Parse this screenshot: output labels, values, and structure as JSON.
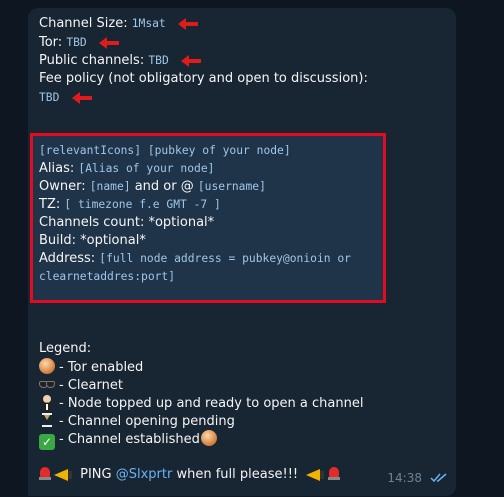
{
  "header": {
    "channel_size_label": "Channel Size:",
    "channel_size_value": "1Msat",
    "tor_label": "Tor:",
    "tor_value": "TBD",
    "public_channels_label": "Public channels:",
    "public_channels_value": "TBD",
    "fee_policy_label": "Fee policy (not obligatory and open to discussion):",
    "fee_policy_value": "TBD"
  },
  "template": {
    "icons_pubkey": "[relevantIcons]  [pubkey of your node]",
    "alias_label": "Alias:",
    "alias_value": "[Alias of your node]",
    "owner_label": "Owner:",
    "owner_name": "[name]",
    "owner_and_or": " and or  @",
    "owner_username": "[username]",
    "tz_label": "TZ:",
    "tz_value": "[ timezone f.e GMT -7 ]",
    "channels_count": "Channels count: *optional*",
    "build": "Build: *optional*",
    "address_label": "Address:",
    "address_value_1": "[full node address = pubkey@onioin or",
    "address_value_2": "clearnetaddres:port]"
  },
  "legend": {
    "title": "Legend:",
    "items": [
      {
        "icon": "onion-icon",
        "text": "- Tor enabled"
      },
      {
        "icon": "sunglasses-icon",
        "text": "- Clearnet"
      },
      {
        "icon": "person-icon",
        "text": "- Node topped up and ready to open a channel"
      },
      {
        "icon": "hourglass-icon",
        "text": "- Channel opening pending"
      },
      {
        "icon": "check-mark-icon",
        "text": "- Channel established"
      }
    ]
  },
  "footer": {
    "ping_text": " PING ",
    "mention": "@Slxprtr",
    "ping_suffix": "  when full please!!!"
  },
  "meta": {
    "time": "14:38"
  },
  "colors": {
    "background": "#0e1621",
    "bubble": "#182533",
    "highlight_border": "#e10c20",
    "arrow": "#e11b1b",
    "link": "#6ab3f3"
  }
}
